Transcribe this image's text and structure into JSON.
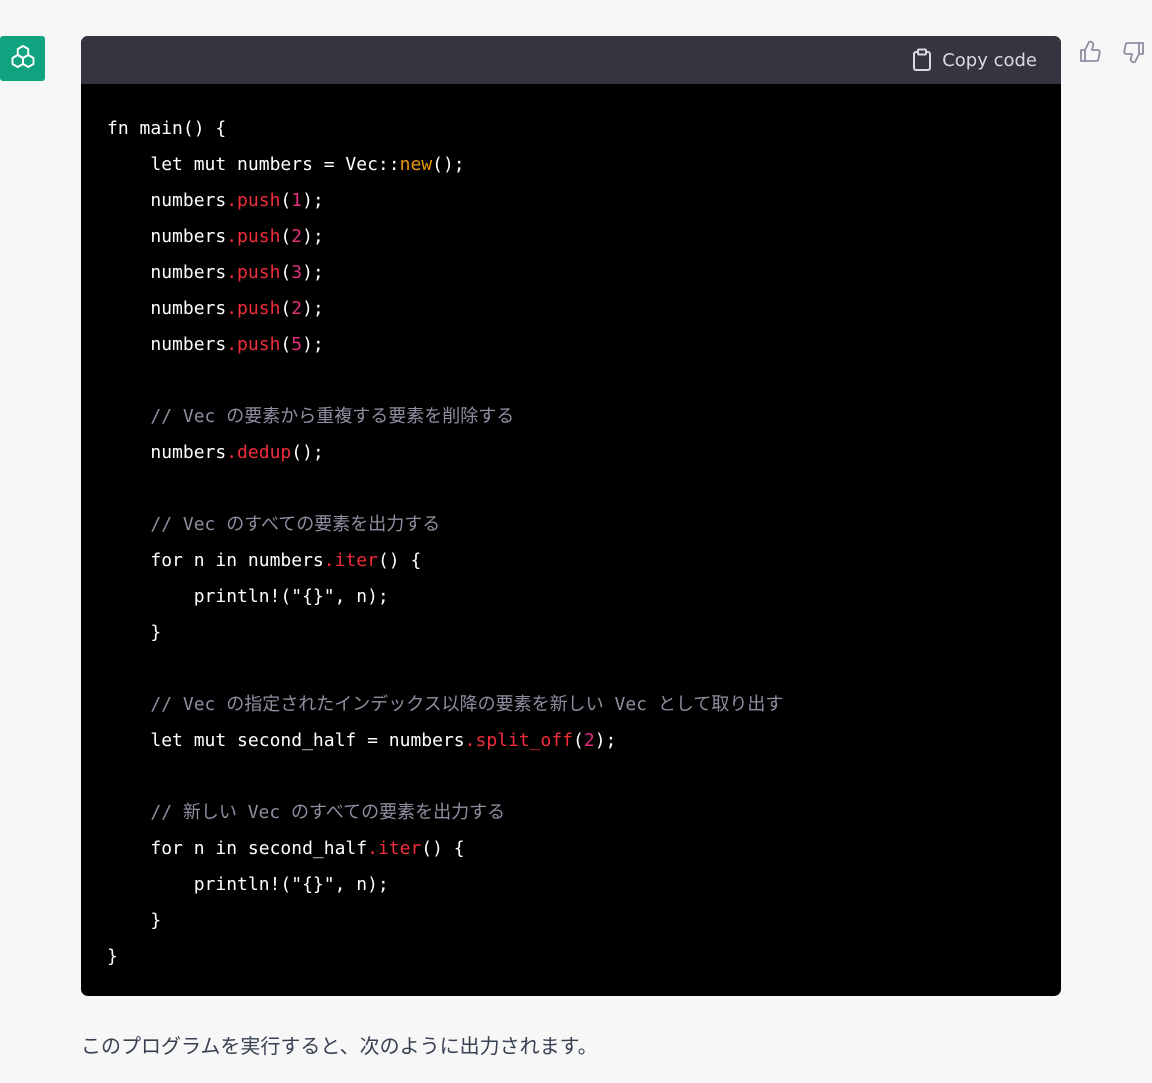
{
  "header": {
    "copy_label": "Copy code"
  },
  "code": {
    "lines": [
      {
        "indent": "",
        "parts": [
          {
            "t": "fn main() {",
            "c": ""
          }
        ]
      },
      {
        "indent": "    ",
        "parts": [
          {
            "t": "let mut numbers = Vec::",
            "c": ""
          },
          {
            "t": "new",
            "c": "c-new"
          },
          {
            "t": "();",
            "c": ""
          }
        ]
      },
      {
        "indent": "    ",
        "parts": [
          {
            "t": "numbers",
            "c": ""
          },
          {
            "t": ".push",
            "c": "c-fn"
          },
          {
            "t": "(",
            "c": ""
          },
          {
            "t": "1",
            "c": "c-num"
          },
          {
            "t": ");",
            "c": ""
          }
        ]
      },
      {
        "indent": "    ",
        "parts": [
          {
            "t": "numbers",
            "c": ""
          },
          {
            "t": ".push",
            "c": "c-fn"
          },
          {
            "t": "(",
            "c": ""
          },
          {
            "t": "2",
            "c": "c-num"
          },
          {
            "t": ");",
            "c": ""
          }
        ]
      },
      {
        "indent": "    ",
        "parts": [
          {
            "t": "numbers",
            "c": ""
          },
          {
            "t": ".push",
            "c": "c-fn"
          },
          {
            "t": "(",
            "c": ""
          },
          {
            "t": "3",
            "c": "c-num"
          },
          {
            "t": ");",
            "c": ""
          }
        ]
      },
      {
        "indent": "    ",
        "parts": [
          {
            "t": "numbers",
            "c": ""
          },
          {
            "t": ".push",
            "c": "c-fn"
          },
          {
            "t": "(",
            "c": ""
          },
          {
            "t": "2",
            "c": "c-num"
          },
          {
            "t": ");",
            "c": ""
          }
        ]
      },
      {
        "indent": "    ",
        "parts": [
          {
            "t": "numbers",
            "c": ""
          },
          {
            "t": ".push",
            "c": "c-fn"
          },
          {
            "t": "(",
            "c": ""
          },
          {
            "t": "5",
            "c": "c-num"
          },
          {
            "t": ");",
            "c": ""
          }
        ]
      },
      {
        "indent": "",
        "parts": []
      },
      {
        "indent": "    ",
        "parts": [
          {
            "t": "// Vec の要素から重複する要素を削除する",
            "c": "c-comment"
          }
        ]
      },
      {
        "indent": "    ",
        "parts": [
          {
            "t": "numbers",
            "c": ""
          },
          {
            "t": ".dedup",
            "c": "c-fn"
          },
          {
            "t": "();",
            "c": ""
          }
        ]
      },
      {
        "indent": "",
        "parts": []
      },
      {
        "indent": "    ",
        "parts": [
          {
            "t": "// Vec のすべての要素を出力する",
            "c": "c-comment"
          }
        ]
      },
      {
        "indent": "    ",
        "parts": [
          {
            "t": "for n in numbers",
            "c": ""
          },
          {
            "t": ".iter",
            "c": "c-fn"
          },
          {
            "t": "() {",
            "c": ""
          }
        ]
      },
      {
        "indent": "        ",
        "parts": [
          {
            "t": "println!(\"{}\", n);",
            "c": ""
          }
        ]
      },
      {
        "indent": "    ",
        "parts": [
          {
            "t": "}",
            "c": ""
          }
        ]
      },
      {
        "indent": "",
        "parts": []
      },
      {
        "indent": "    ",
        "parts": [
          {
            "t": "// Vec の指定されたインデックス以降の要素を新しい Vec として取り出す",
            "c": "c-comment"
          }
        ]
      },
      {
        "indent": "    ",
        "parts": [
          {
            "t": "let mut second_half = numbers",
            "c": ""
          },
          {
            "t": ".split_off",
            "c": "c-fn"
          },
          {
            "t": "(",
            "c": ""
          },
          {
            "t": "2",
            "c": "c-num"
          },
          {
            "t": ");",
            "c": ""
          }
        ]
      },
      {
        "indent": "",
        "parts": []
      },
      {
        "indent": "    ",
        "parts": [
          {
            "t": "// 新しい Vec のすべての要素を出力する",
            "c": "c-comment"
          }
        ]
      },
      {
        "indent": "    ",
        "parts": [
          {
            "t": "for n in second_half",
            "c": ""
          },
          {
            "t": ".iter",
            "c": "c-fn"
          },
          {
            "t": "() {",
            "c": ""
          }
        ]
      },
      {
        "indent": "        ",
        "parts": [
          {
            "t": "println!(\"{}\", n);",
            "c": ""
          }
        ]
      },
      {
        "indent": "    ",
        "parts": [
          {
            "t": "}",
            "c": ""
          }
        ]
      },
      {
        "indent": "",
        "parts": [
          {
            "t": "}",
            "c": ""
          }
        ]
      }
    ]
  },
  "answer": {
    "text": "このプログラムを実行すると、次のように出力されます。"
  },
  "colors": {
    "accent": "#10a37f",
    "code_bg": "#000000",
    "header_bg": "#343541"
  }
}
